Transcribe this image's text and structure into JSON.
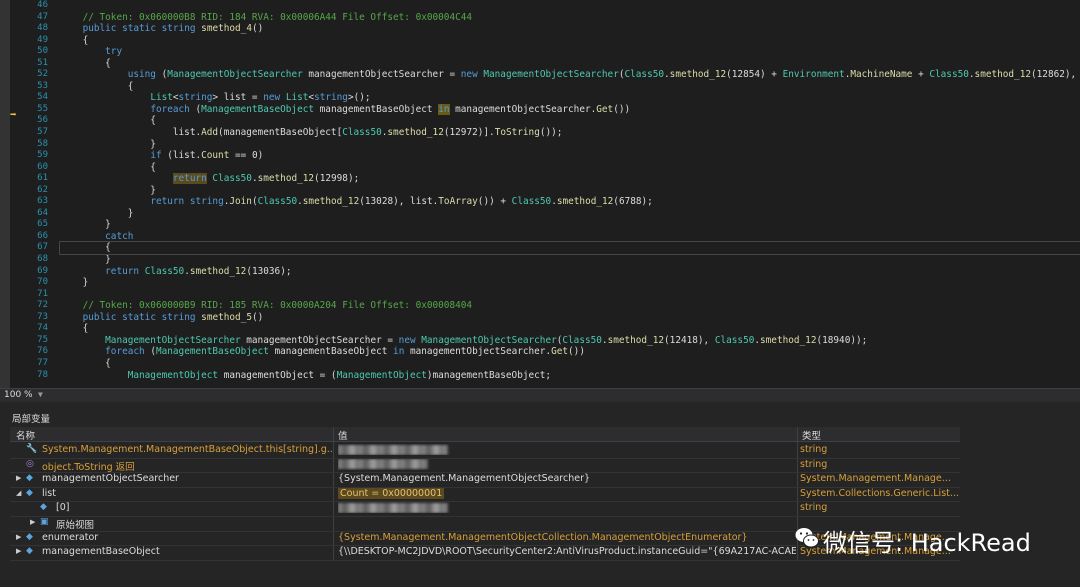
{
  "editor": {
    "line_numbers": [
      "46",
      "47",
      "48",
      "49",
      "50",
      "51",
      "52",
      "53",
      "54",
      "55",
      "56",
      "57",
      "58",
      "59",
      "60",
      "61",
      "62",
      "63",
      "64",
      "65",
      "66",
      "67",
      "68",
      "69",
      "70",
      "71",
      "72",
      "73",
      "74",
      "75",
      "76",
      "77",
      "78"
    ],
    "current_line_index": 9,
    "lines": [
      "",
      "    // Token: 0x060000B8 RID: 184 RVA: 0x00006A44 File Offset: 0x00004C44",
      "    public static string smethod_4()",
      "    {",
      "        try",
      "        {",
      "            using (ManagementObjectSearcher managementObjectSearcher = new ManagementObjectSearcher(Class50.smethod_12(12854) + Environment.MachineName + Class50.smethod_12(12862),",
      "            {",
      "                List<string> list = new List<string>();",
      "                foreach (ManagementBaseObject managementBaseObject in managementObjectSearcher.Get())",
      "                {",
      "                    list.Add(managementBaseObject[Class50.smethod_12(12972)].ToString());",
      "                }",
      "                if (list.Count == 0)",
      "                {",
      "                    return Class50.smethod_12(12998);",
      "                }",
      "                return string.Join(Class50.smethod_12(13028), list.ToArray()) + Class50.smethod_12(6788);",
      "            }",
      "        }",
      "        catch",
      "        {",
      "        }",
      "        return Class50.smethod_12(13036);",
      "    }",
      "",
      "    // Token: 0x060000B9 RID: 185 RVA: 0x0000A204 File Offset: 0x00008404",
      "    public static string smethod_5()",
      "    {",
      "        ManagementObjectSearcher managementObjectSearcher = new ManagementObjectSearcher(Class50.smethod_12(12418), Class50.smethod_12(18940));",
      "        foreach (ManagementBaseObject managementBaseObject in managementObjectSearcher.Get())",
      "        {",
      "            ManagementObject managementObject = (ManagementObject)managementBaseObject;"
    ]
  },
  "statusbar": {
    "zoom": "100 %"
  },
  "locals_panel": {
    "title": "局部变量",
    "columns": {
      "name": "名称",
      "value": "值",
      "type": "类型"
    },
    "rows": [
      {
        "name": "System.Management.ManagementBaseObject.this[string].g...",
        "value": "",
        "type": "string",
        "icon": "wrench-icon",
        "expander": "",
        "indent": 0,
        "name_color": "orange",
        "redacted": true
      },
      {
        "name": "object.ToString 返回",
        "value": "",
        "type": "string",
        "icon": "method-return-icon",
        "expander": "",
        "indent": 0,
        "name_color": "mixed",
        "redacted": true
      },
      {
        "name": "managementObjectSearcher",
        "value": "{System.Management.ManagementObjectSearcher}",
        "type": "System.Management.Manage...",
        "icon": "local-variable-icon",
        "expander": "▶",
        "indent": 0,
        "name_color": "plain",
        "redacted": false
      },
      {
        "name": "list",
        "value": "Count = 0x00000001",
        "type": "System.Collections.Generic.List...",
        "icon": "local-variable-icon",
        "expander": "◢",
        "indent": 0,
        "name_color": "plain",
        "redacted": false
      },
      {
        "name": "[0]",
        "value": "",
        "type": "string",
        "icon": "local-variable-icon",
        "expander": "",
        "indent": 1,
        "name_color": "plain",
        "redacted": true
      },
      {
        "name": "原始视图",
        "value": "",
        "type": "",
        "icon": "raw-view-icon",
        "expander": "▶",
        "indent": 1,
        "name_color": "plain",
        "redacted": false
      },
      {
        "name": "enumerator",
        "value": "{System.Management.ManagementObjectCollection.ManagementObjectEnumerator}",
        "type": "System.Management.Manage...",
        "icon": "local-variable-icon",
        "expander": "▶",
        "indent": 0,
        "name_color": "plain",
        "redacted": false
      },
      {
        "name": "managementBaseObject",
        "value": "{\\\\DESKTOP-MC2JDVD\\ROOT\\SecurityCenter2:AntiVirusProduct.instanceGuid=\"{69A217AC-ACAE...",
        "type": "System.Management.Manage...",
        "icon": "local-variable-icon",
        "expander": "▶",
        "indent": 0,
        "name_color": "plain",
        "redacted": false
      }
    ]
  },
  "watermark": {
    "text": "微信号: HackRead",
    "icon": "wechat-icon"
  },
  "colors": {
    "keyword": "#569cd6",
    "type": "#4ec9b0",
    "method": "#dcdcaa",
    "comment": "#57a64a",
    "orange_value": "#d7a037"
  }
}
